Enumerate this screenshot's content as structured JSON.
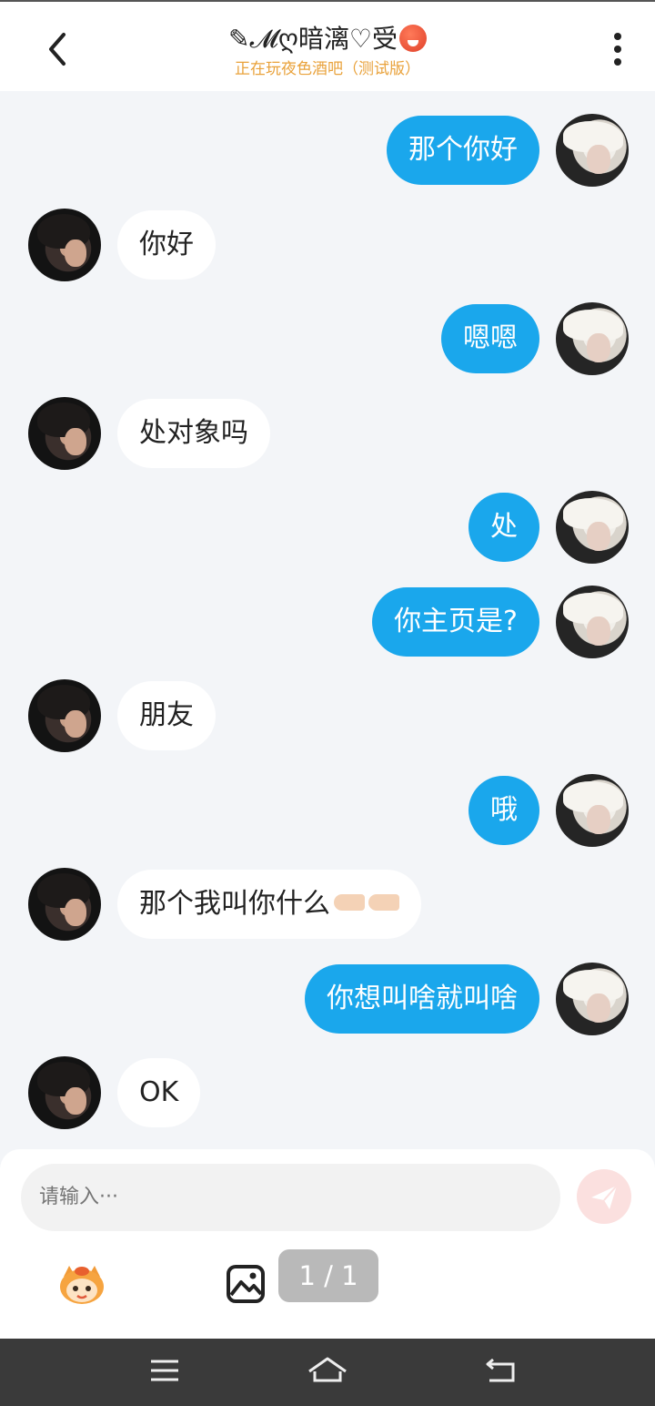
{
  "header": {
    "title_prefix": "✎𝓜ღ暗漓♡受",
    "subtitle": "正在玩夜色酒吧（测试版）"
  },
  "messages": [
    {
      "side": "right",
      "text": "那个你好"
    },
    {
      "side": "left",
      "text": "你好"
    },
    {
      "side": "right",
      "text": "嗯嗯"
    },
    {
      "side": "left",
      "text": "处对象吗"
    },
    {
      "side": "right",
      "text": "处"
    },
    {
      "side": "right",
      "text": "你主页是?"
    },
    {
      "side": "left",
      "text": "朋友"
    },
    {
      "side": "right",
      "text": "哦"
    },
    {
      "side": "left",
      "text": "那个我叫你什么"
    },
    {
      "side": "right",
      "text": "你想叫啥就叫啥"
    },
    {
      "side": "left",
      "text": "OK"
    }
  ],
  "composer": {
    "placeholder": "请输入···",
    "page_indicator": "1 / 1"
  },
  "colors": {
    "outgoing_bubble": "#1aa7ec",
    "incoming_bubble": "#ffffff",
    "subtitle": "#e9a23b",
    "send_button": "#fbe0df"
  },
  "icons": {
    "back": "chevron-left-icon",
    "menu": "more-vertical-icon",
    "send": "paper-plane-icon",
    "emoji": "mascot-icon",
    "image": "image-icon"
  }
}
